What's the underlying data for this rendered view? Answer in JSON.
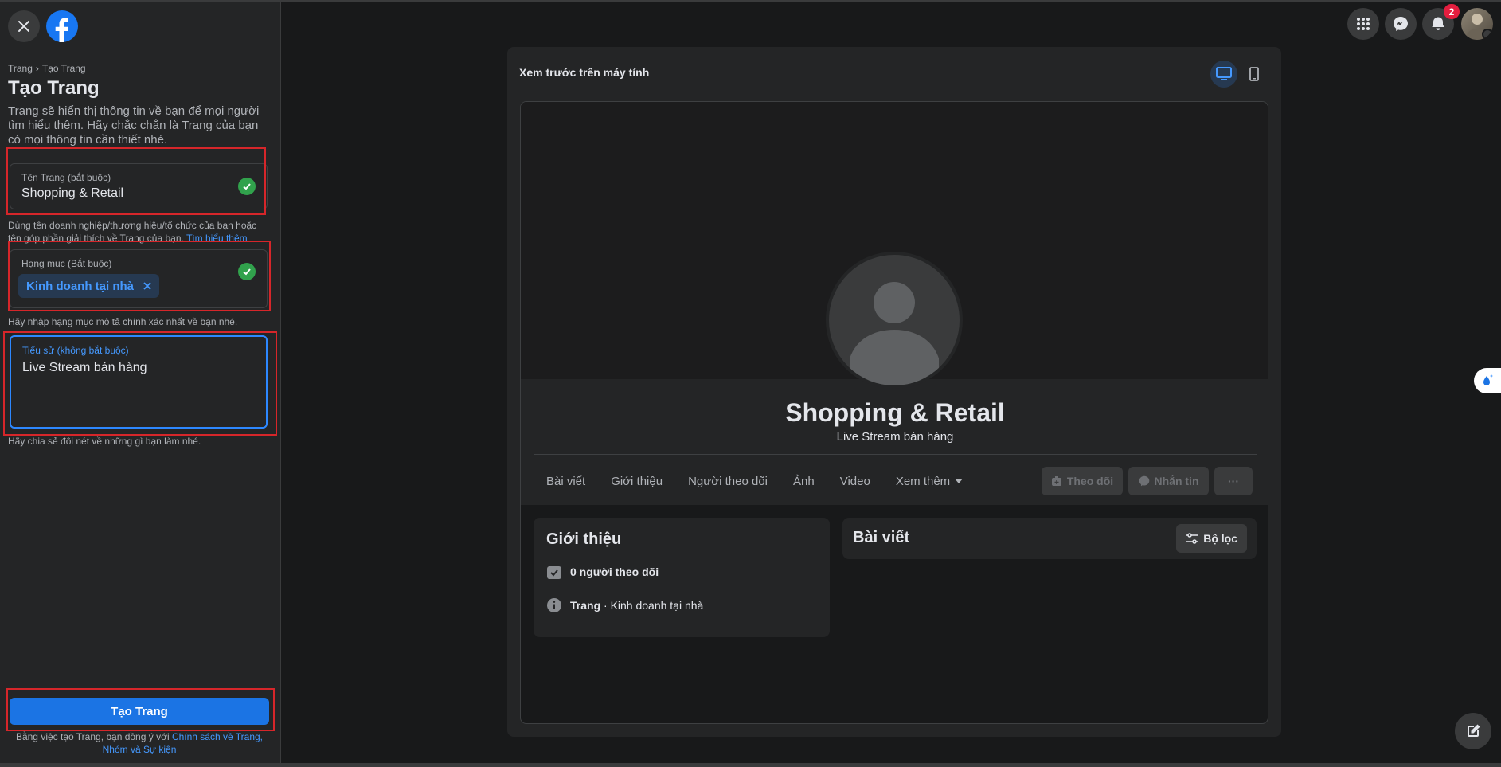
{
  "sidebar": {
    "breadcrumb": [
      "Trang",
      "Tạo Trang"
    ],
    "title": "Tạo Trang",
    "description": "Trang sẽ hiển thị thông tin về bạn để mọi người tìm hiểu thêm. Hãy chắc chắn là Trang của bạn có mọi thông tin cần thiết nhé.",
    "name_field": {
      "label": "Tên Trang (bắt buộc)",
      "value": "Shopping & Retail",
      "hint": "Dùng tên doanh nghiệp/thương hiệu/tổ chức của bạn hoặc tên góp phần giải thích về Trang của bạn. ",
      "hint_link": "Tìm hiểu thêm"
    },
    "category_field": {
      "label": "Hạng mục (Bắt buộc)",
      "chip": "Kinh doanh tại nhà",
      "hint": "Hãy nhập hạng mục mô tả chính xác nhất về bạn nhé."
    },
    "bio_field": {
      "label": "Tiểu sử (không bắt buộc)",
      "value": "Live Stream bán hàng",
      "hint": "Hãy chia sẻ đôi nét về những gì bạn làm nhé."
    },
    "create_button": "Tạo Trang",
    "terms_prefix": "Bằng việc tạo Trang, bạn đồng ý với ",
    "terms_link": "Chính sách về Trang, Nhóm và Sự kiện"
  },
  "topbar": {
    "notification_count": "2",
    "icons": [
      "menu-grid-icon",
      "messenger-icon",
      "bell-icon",
      "avatar"
    ]
  },
  "preview": {
    "title": "Xem trước trên máy tính",
    "page_name": "Shopping & Retail",
    "page_bio": "Live Stream bán hàng",
    "tabs": [
      "Bài viết",
      "Giới thiệu",
      "Người theo dõi",
      "Ảnh",
      "Video",
      "Xem thêm"
    ],
    "actions": {
      "follow": "Theo dõi",
      "message": "Nhắn tin",
      "more": "···"
    },
    "intro": {
      "title": "Giới thiệu",
      "followers": "0 người theo dõi",
      "type_bold": "Trang",
      "type_rest": " · Kinh doanh tại nhà"
    },
    "posts": {
      "title": "Bài viết",
      "filter": "Bộ lọc"
    }
  },
  "colors": {
    "accent": "#1b74e4",
    "link": "#4599ff",
    "highlight_border": "#d6262a",
    "success": "#31a24c",
    "badge": "#e41e3f"
  }
}
